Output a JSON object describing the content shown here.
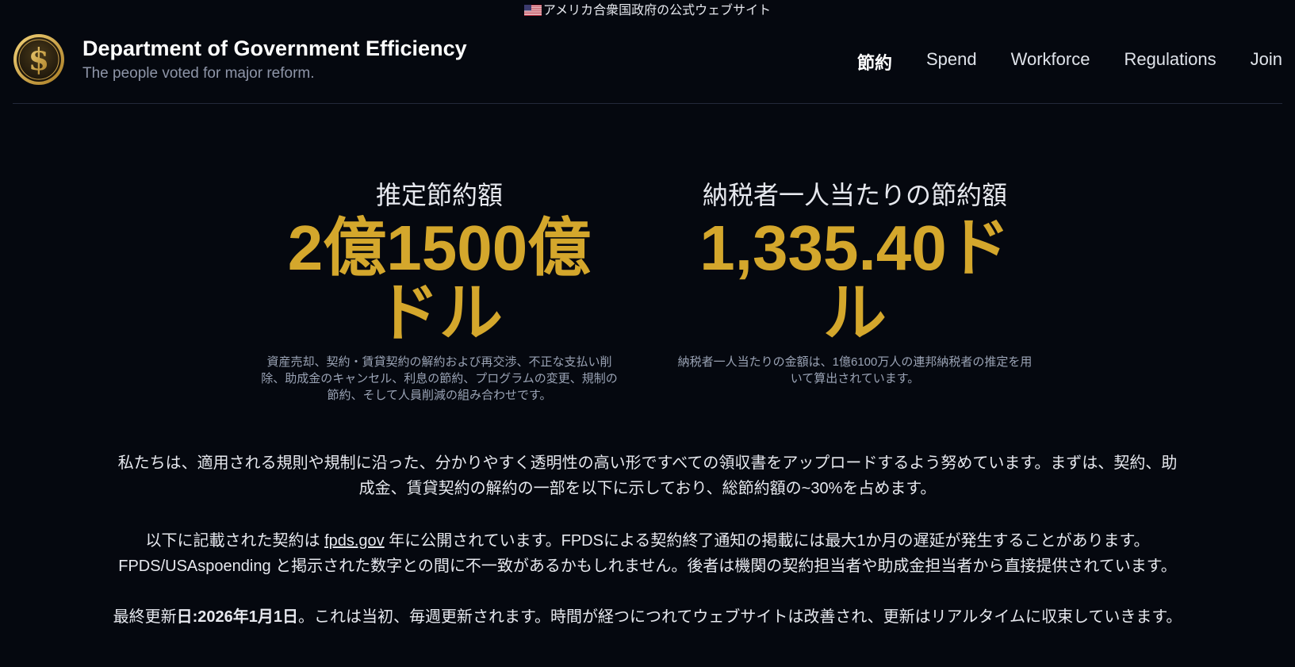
{
  "gov_banner": {
    "text": "アメリカ合衆国政府の公式ウェブサイト"
  },
  "header": {
    "title": "Department of Government Efficiency",
    "tagline": "The people voted for major reform.",
    "nav": [
      {
        "label": "節約",
        "active": true
      },
      {
        "label": "Spend",
        "active": false
      },
      {
        "label": "Workforce",
        "active": false
      },
      {
        "label": "Regulations",
        "active": false
      },
      {
        "label": "Join",
        "active": false
      }
    ]
  },
  "stats": {
    "estimated": {
      "label": "推定節約額",
      "value": "2億1500億ドル",
      "note": "資産売却、契約・賃貸契約の解約および再交渉、不正な支払い削除、助成金のキャンセル、利息の節約、プログラムの変更、規制の節約、そして人員削減の組み合わせです。"
    },
    "per_taxpayer": {
      "label": "納税者一人当たりの節約額",
      "value": "1,335.40ドル",
      "note": "納税者一人当たりの金額は、1億6100万人の連邦納税者の推定を用いて算出されています。"
    }
  },
  "paragraphs": {
    "p1": "私たちは、適用される規則や規制に沿った、分かりやすく透明性の高い形ですべての領収書をアップロードするよう努めています。まずは、契約、助成金、賃貸契約の解約の一部を以下に示しており、総節約額の~30%を占めます。",
    "p2_before": "以下に記載された契約は ",
    "p2_link": "fpds.gov",
    "p2_after": " 年に公開されています。FPDSによる契約終了通知の掲載には最大1か月の遅延が発生することがあります。FPDS/USAspoending と掲示された数字との間に不一致があるかもしれません。後者は機関の契約担当者や助成金担当者から直接提供されています。",
    "p3_prefix": "最終更新",
    "p3_bold": "日:2026年1月1日",
    "p3_after": "。これは当初、毎週更新されます。時間が経つにつれてウェブサイトは改善され、更新はリアルタイムに収束していきます。"
  },
  "colors": {
    "background": "#05080f",
    "accent_gold": "#d4a72c",
    "muted_text": "#9aa3b5"
  }
}
